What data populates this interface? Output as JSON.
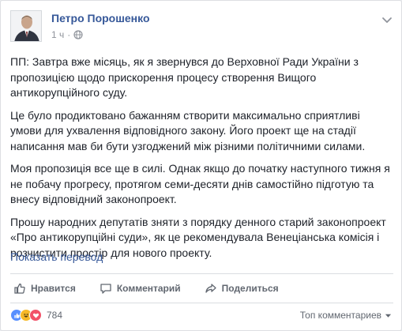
{
  "post": {
    "author": "Петро Порошенко",
    "time": "1 ч",
    "separator": "·",
    "paragraphs": [
      "ПП: Завтра вже місяць, як я звернувся до Верховної Ради України з пропозицією щодо прискорення процесу створення Вищого антикорупційного суду.",
      "Це було продиктовано бажанням створити максимально сприятливі умови для ухвалення відповідного закону. Його проект ще на стадії написання мав би бути узгоджений між різними політичними силами.",
      "Моя пропозиція все ще в силі. Однак якщо до початку наступного тижня я не побачу прогресу, протягом семи-десяти днів самостійно підготую та внесу відповідний законопроект.",
      "Прошу народних депутатів зняти з порядку денного старий законопроект «Про антикорупційні суди», як це рекомендувала Венеціанська комісія і розчистити простір для нового проекту."
    ],
    "translate_link": "Показать перевод"
  },
  "actions": {
    "like": "Нравится",
    "comment": "Комментарий",
    "share": "Поделиться"
  },
  "reactions": {
    "icons": [
      "like-icon",
      "laugh-icon",
      "love-icon"
    ],
    "count": "784"
  },
  "comments_filter": "Топ комментариев",
  "colors": {
    "link": "#365899",
    "text": "#1d2129",
    "muted": "#90949c",
    "like_blue": "#5890ff",
    "haha_yellow": "#f7b928",
    "love_red": "#f25268"
  }
}
